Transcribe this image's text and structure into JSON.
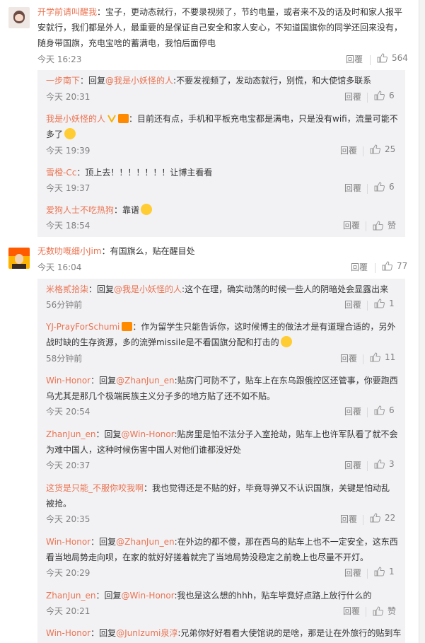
{
  "c1": {
    "user": "开学前请叫醒我",
    "text": "：宝子，更动态就行，不要录视频了，节约电量，或者来不及的话及时和家人报平安就行，我们都是外人，最重要的是保证自己安全和家人安心，不知道国旗你的同学还回来没有，随身带国旗，充电宝啥的蓄满电，我怕后面停电",
    "time": "今天 16:23",
    "reply": "回覆",
    "likes": "564",
    "subs": [
      {
        "user": "一步南下",
        "pre": "：回复",
        "at": "@我是小妖怪的人",
        "text": ":不要发视频了，发动态就行，别慌，和大使馆多联系",
        "time": "今天 20:31",
        "reply": "回覆",
        "likes": "6"
      },
      {
        "user": "我是小妖怪的人",
        "text": "：目前还有点，手机和平板充电宝都是满电，只是没有wifi，流量可能不多了",
        "time": "今天 19:39",
        "reply": "回覆",
        "likes": "25"
      },
      {
        "user": "雪橙-Cc",
        "text": "：顶上去！！！！！！！让博主看看",
        "time": "今天 19:37",
        "reply": "回覆",
        "likes": "6"
      },
      {
        "user": "爱狗人士不吃热狗",
        "text": "：靠谱",
        "time": "今天 18:54",
        "reply": "回覆",
        "likes": "赞"
      }
    ]
  },
  "c2": {
    "user": "无数叻嘅细小Jim",
    "text": "：有国旗么，贴在醒目处",
    "time": "今天 16:04",
    "reply": "回覆",
    "likes": "77",
    "subs": [
      {
        "user": "米格贰拾柒",
        "pre": "：回复",
        "at": "@我是小妖怪的人",
        "text": ":这个在理，确实动荡的时候一些人的阴暗处会显露出来",
        "time": "56分钟前",
        "reply": "回覆",
        "likes": "1"
      },
      {
        "user": "YJ-PrayForSchumi",
        "text": "：作为留学生只能告诉你，这时候博主的做法才是有道理合适的，另外战时缺的生存资源，多的流弹missile是不看国旗分配和打击的",
        "time": "58分钟前",
        "reply": "回覆",
        "likes": "11"
      },
      {
        "user": "Win-Honor",
        "pre": "：回复",
        "at": "@ZhanJun_en",
        "text": ":贴房门可防不了，贴车上在东乌跟俄控区还管事，你要跑西乌尤其是那几个极端民族主义分子多的地方贴了还不如不贴。",
        "time": "今天 20:54",
        "reply": "回覆",
        "likes": "6"
      },
      {
        "user": "ZhanJun_en",
        "pre": "：回复",
        "at": "@Win-Honor",
        "text": ":贴房里是怕不法分子入室抢劫，贴车上也许军队看了就不会为难中国人，这种时候伤害中国人对他们谁都没好处",
        "time": "今天 20:37",
        "reply": "回覆",
        "likes": "3"
      },
      {
        "user": "这货是只能_不服你咬我啊",
        "text": "：我也觉得还是不贴的好，毕竟导弹又不认识国旗，关键是怕动乱被抢。",
        "time": "今天 20:35",
        "reply": "回覆",
        "likes": "22"
      },
      {
        "user": "Win-Honor",
        "pre": "：回复",
        "at": "@ZhanJun_en",
        "text": ":在外边的都不傻，那在西乌的贴车上也不一定安全，这东西看当地局势走向呗，在家的就好好搓着就完了当地局势没稳定之前晚上也尽量不开灯。",
        "time": "今天 20:29",
        "reply": "回覆",
        "likes": "1"
      },
      {
        "user": "ZhanJun_en",
        "pre": "：回复",
        "at": "@Win-Honor",
        "text": ":我也是这么想的hhh，贴车毕竟好点路上放行什么的",
        "time": "今天 20:21",
        "reply": "回覆",
        "likes": "赞"
      },
      {
        "user": "Win-Honor",
        "pre": "：回复",
        "at": "@JunIzumi泉淳",
        "text": ":兄弟你好好看看大使馆说的是啥，那是让在外旅行的贴到车",
        "time": "",
        "reply": "",
        "likes": ""
      }
    ]
  }
}
